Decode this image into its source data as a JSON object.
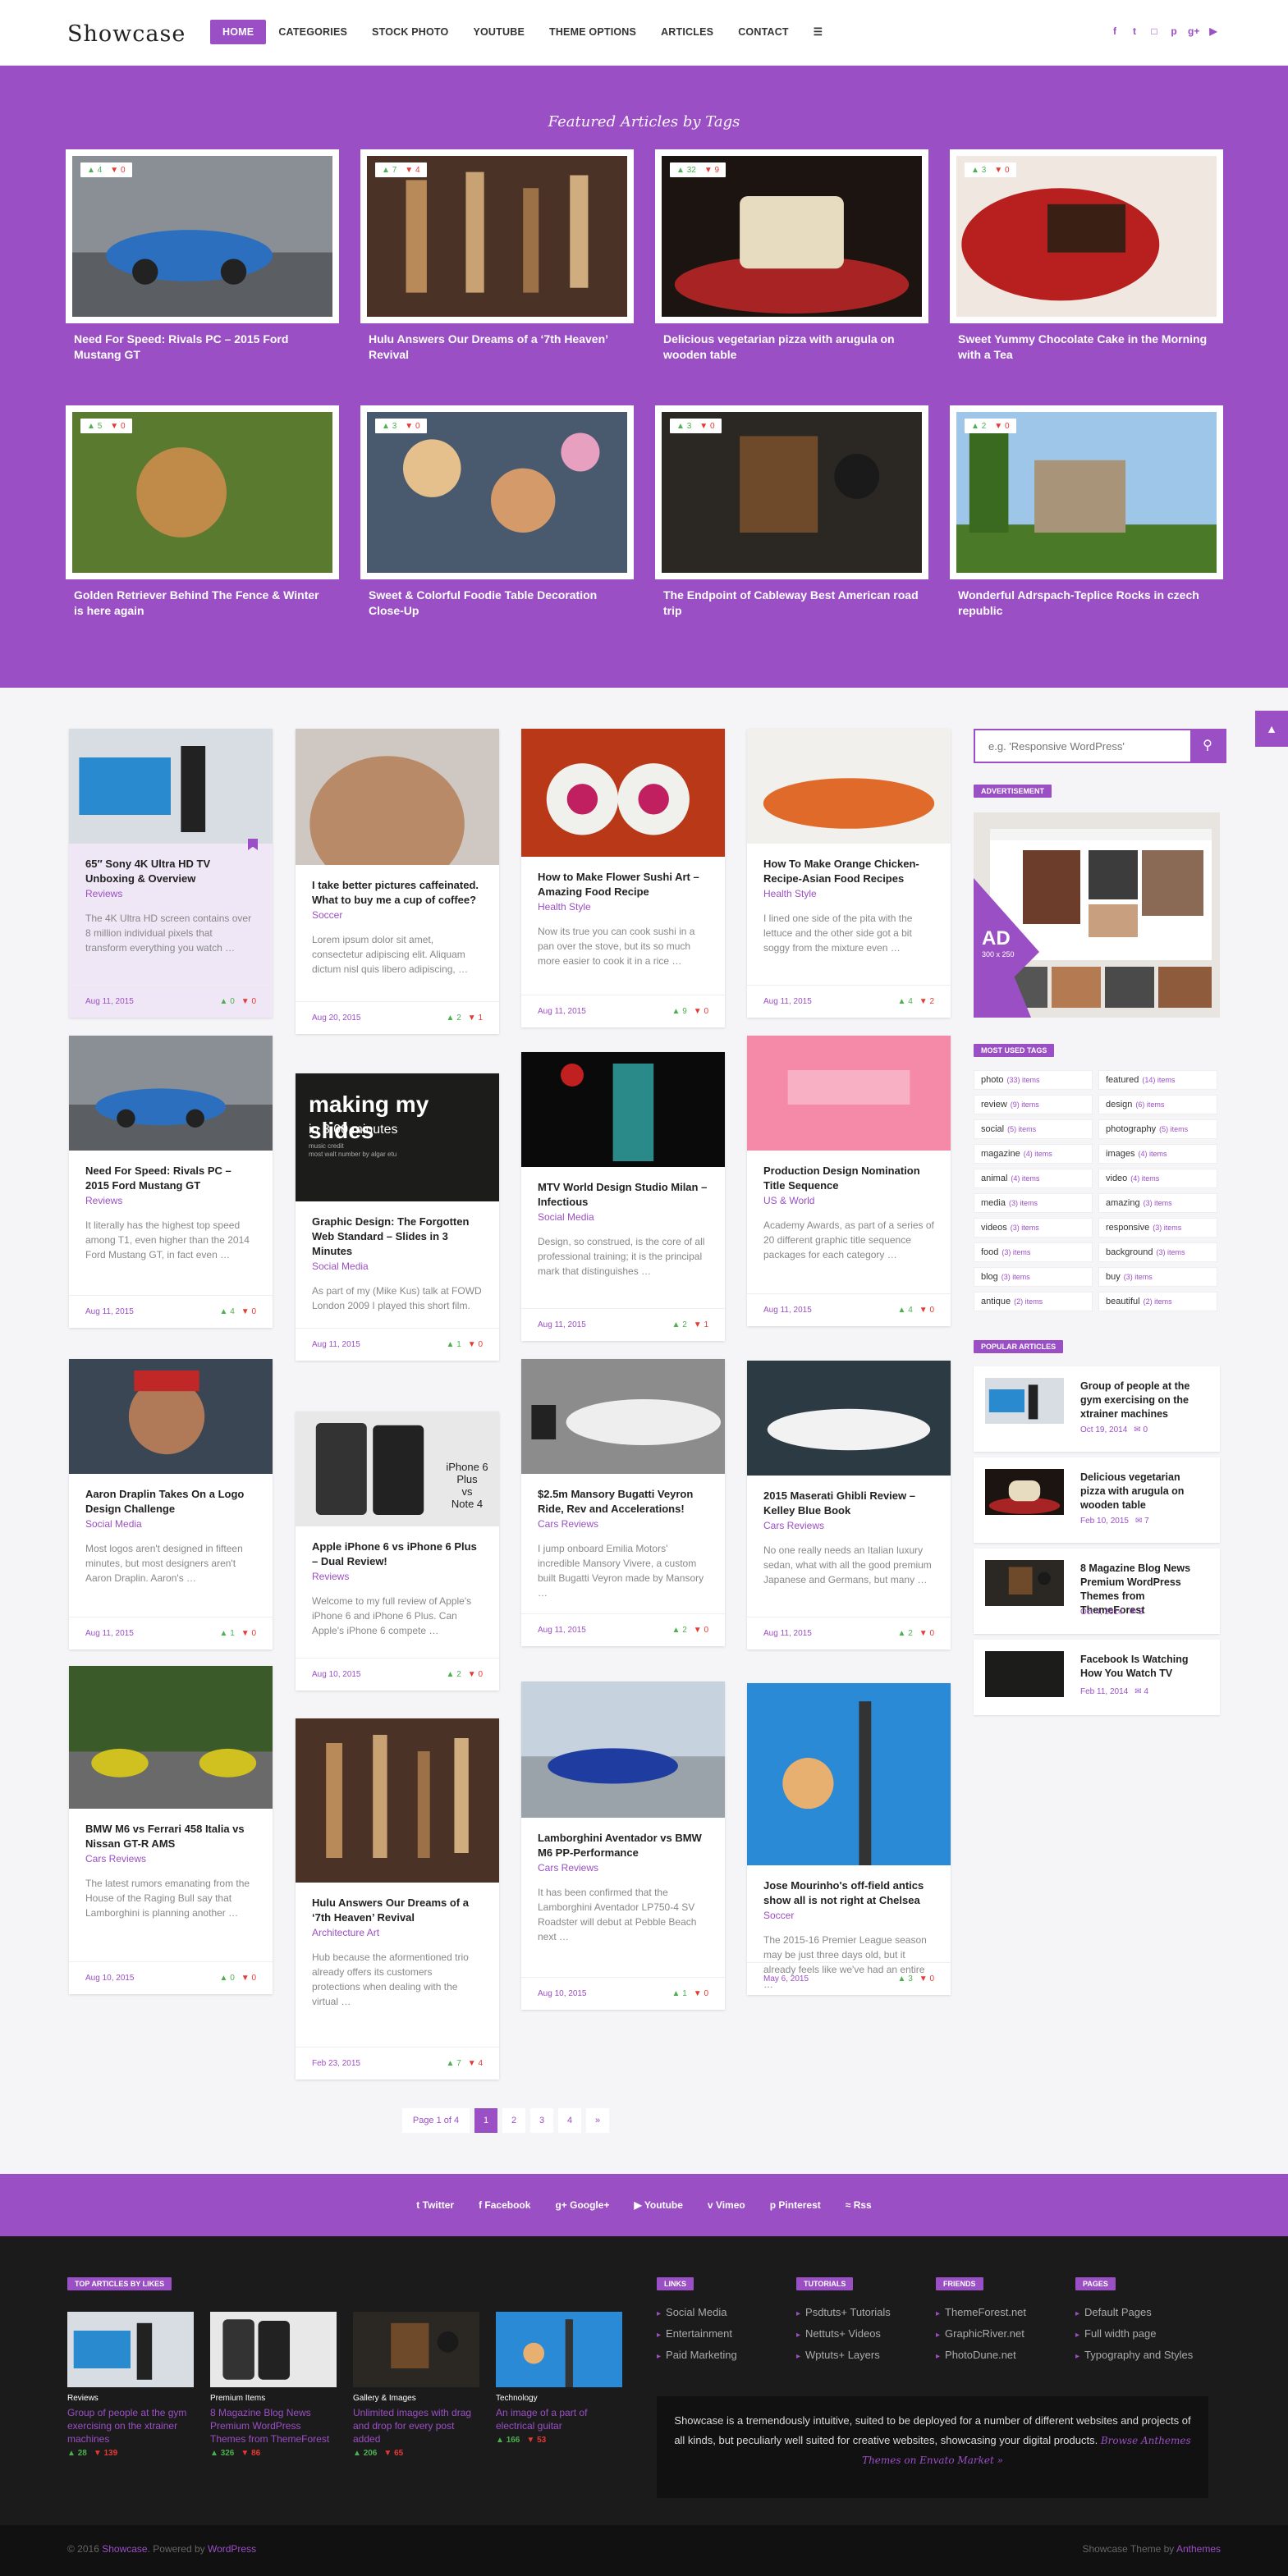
{
  "header": {
    "logo": "Showcase",
    "nav": [
      "Home",
      "Categories",
      "Stock Photo",
      "Youtube",
      "Theme Options",
      "Articles",
      "Contact"
    ],
    "menu_icon": "hamburger-icon",
    "social_icons": [
      "facebook-icon",
      "twitter-icon",
      "instagram-icon",
      "pinterest-icon",
      "google-plus-icon",
      "youtube-icon"
    ]
  },
  "featured": {
    "title": "Featured Articles by Tags",
    "items": [
      {
        "title": "Need For Speed: Rivals PC – 2015 Ford Mustang GT",
        "likes": "4",
        "dislikes": "0"
      },
      {
        "title": "Hulu Answers Our Dreams of a ‘7th Heaven’ Revival",
        "likes": "7",
        "dislikes": "4"
      },
      {
        "title": "Delicious vegetarian pizza with arugula on wooden table",
        "likes": "32",
        "dislikes": "9"
      },
      {
        "title": "Sweet Yummy Chocolate Cake in the Morning with a Tea",
        "likes": "3",
        "dislikes": "0"
      },
      {
        "title": "Golden Retriever Behind The Fence & Winter is here again",
        "likes": "5",
        "dislikes": "0"
      },
      {
        "title": "Sweet & Colorful Foodie Table Decoration Close-Up",
        "likes": "3",
        "dislikes": "0"
      },
      {
        "title": "The Endpoint of Cableway Best American road trip",
        "likes": "3",
        "dislikes": "0"
      },
      {
        "title": "Wonderful Adrspach-Teplice Rocks in czech republic",
        "likes": "2",
        "dislikes": "0"
      }
    ]
  },
  "posts": [
    {
      "title": "65″ Sony 4K Ultra HD TV Unboxing & Overview",
      "cat": "Reviews",
      "excerpt": "The 4K Ultra HD screen contains over 8 million individual pixels that transform everything you watch …",
      "date": "Aug 11, 2015",
      "likes": "0",
      "dislikes": "0"
    },
    {
      "title": "I take better pictures caffeinated. What to buy me a cup of coffee?",
      "cat": "Soccer",
      "excerpt": "Lorem ipsum dolor sit amet, consectetur adipiscing elit. Aliquam dictum nisl quis libero adipiscing, …",
      "date": "Aug 20, 2015",
      "likes": "2",
      "dislikes": "1"
    },
    {
      "title": "How to Make Flower Sushi Art – Amazing Food Recipe",
      "cat": "Health Style",
      "excerpt": "Now its true you can cook sushi in a pan over the stove, but its so much more easier to cook it in a rice …",
      "date": "Aug 11, 2015",
      "likes": "9",
      "dislikes": "0"
    },
    {
      "title": "How To Make Orange Chicken-Recipe-Asian Food Recipes",
      "cat": "Health Style",
      "excerpt": "I lined one side of the pita with the lettuce and the other side got a bit soggy from the mixture even …",
      "date": "Aug 11, 2015",
      "likes": "4",
      "dislikes": "2"
    },
    {
      "title": "Need For Speed: Rivals PC – 2015 Ford Mustang GT",
      "cat": "Reviews",
      "excerpt": "It literally has the highest top speed among T1, even higher than the 2014 Ford Mustang GT, in fact even …",
      "date": "Aug 11, 2015",
      "likes": "4",
      "dislikes": "0"
    },
    {
      "title": "Graphic Design: The Forgotten Web Standard – Slides in 3 Minutes",
      "cat": "Social Media",
      "excerpt": "As part of my (Mike Kus) talk at FOWD London 2009 I played this short film.",
      "date": "Aug 11, 2015",
      "likes": "1",
      "dislikes": "0"
    },
    {
      "title": "MTV World Design Studio Milan – Infectious",
      "cat": "Social Media",
      "excerpt": "Design, so construed, is the core of all professional training; it is the principal mark that distinguishes …",
      "date": "Aug 11, 2015",
      "likes": "2",
      "dislikes": "1"
    },
    {
      "title": "Production Design Nomination Title Sequence",
      "cat": "US & World",
      "excerpt": "Academy Awards, as part of a series of 20 different graphic title sequence packages for each category …",
      "date": "Aug 11, 2015",
      "likes": "4",
      "dislikes": "0"
    },
    {
      "title": "Aaron Draplin Takes On a Logo Design Challenge",
      "cat": "Social Media",
      "excerpt": "Most logos aren't designed in fifteen minutes, but most designers aren't Aaron Draplin. Aaron's …",
      "date": "Aug 11, 2015",
      "likes": "1",
      "dislikes": "0"
    },
    {
      "title": "Apple iPhone 6 vs iPhone 6 Plus – Dual Review!",
      "cat": "Reviews",
      "excerpt": "Welcome to my full review of Apple's iPhone 6 and iPhone 6 Plus. Can Apple's iPhone 6 compete …",
      "date": "Aug 10, 2015",
      "likes": "2",
      "dislikes": "0"
    },
    {
      "title": "$2.5m Mansory Bugatti Veyron Ride, Rev and Accelerations!",
      "cat": "Cars Reviews",
      "excerpt": "I jump onboard Emilia Motors' incredible Mansory Vivere, a custom built Bugatti Veyron made by Mansory …",
      "date": "Aug 11, 2015",
      "likes": "2",
      "dislikes": "0"
    },
    {
      "title": "2015 Maserati Ghibli Review – Kelley Blue Book",
      "cat": "Cars Reviews",
      "excerpt": "No one really needs an Italian luxury sedan, what with all the good premium Japanese and Germans, but many …",
      "date": "Aug 11, 2015",
      "likes": "2",
      "dislikes": "0"
    },
    {
      "title": "BMW M6 vs Ferrari 458 Italia vs Nissan GT-R AMS",
      "cat": "Cars Reviews",
      "excerpt": "The latest rumors emanating from the House of the Raging Bull say that Lamborghini is planning another …",
      "date": "Aug 10, 2015",
      "likes": "0",
      "dislikes": "0"
    },
    {
      "title": "Hulu Answers Our Dreams of a ‘7th Heaven’ Revival",
      "cat": "Architecture Art",
      "excerpt": "Hub because the aformentioned trio already offers its customers protections when dealing with the virtual …",
      "date": "Feb 23, 2015",
      "likes": "7",
      "dislikes": "4"
    },
    {
      "title": "Lamborghini Aventador vs BMW M6 PP-Performance",
      "cat": "Cars Reviews",
      "excerpt": "It has been confirmed that the Lamborghini Aventador LP750-4 SV Roadster will debut at Pebble Beach next …",
      "date": "Aug 10, 2015",
      "likes": "1",
      "dislikes": "0"
    },
    {
      "title": "Jose Mourinho's off-field antics show all is not right at Chelsea",
      "cat": "Soccer",
      "excerpt": "The 2015-16 Premier League season may be just three days old, but it already feels like we've had an entire …",
      "date": "May 6, 2015",
      "likes": "3",
      "dislikes": "0"
    }
  ],
  "img_texts": {
    "slides_big": "making my slides",
    "slides_small": "in 3.00 minutes",
    "slides_tiny": "music credit\nmost walt number by algar etu",
    "iphone": "iPhone 6 Plus\nvs\nNote 4"
  },
  "sidebar": {
    "search_placeholder": "e.g. 'Responsive WordPress'",
    "ad_label": "Advertisement",
    "ad_text": "AD",
    "ad_size": "300 x 250",
    "tags_label": "Most Used Tags",
    "tags": [
      {
        "name": "photo",
        "count": "(33) items"
      },
      {
        "name": "featured",
        "count": "(14) items"
      },
      {
        "name": "review",
        "count": "(9) items"
      },
      {
        "name": "design",
        "count": "(6) items"
      },
      {
        "name": "social",
        "count": "(5) items"
      },
      {
        "name": "photography",
        "count": "(5) items"
      },
      {
        "name": "magazine",
        "count": "(4) items"
      },
      {
        "name": "images",
        "count": "(4) items"
      },
      {
        "name": "animal",
        "count": "(4) items"
      },
      {
        "name": "video",
        "count": "(4) items"
      },
      {
        "name": "media",
        "count": "(3) items"
      },
      {
        "name": "amazing",
        "count": "(3) items"
      },
      {
        "name": "videos",
        "count": "(3) items"
      },
      {
        "name": "responsive",
        "count": "(3) items"
      },
      {
        "name": "food",
        "count": "(3) items"
      },
      {
        "name": "background",
        "count": "(3) items"
      },
      {
        "name": "blog",
        "count": "(3) items"
      },
      {
        "name": "buy",
        "count": "(3) items"
      },
      {
        "name": "antique",
        "count": "(2) items"
      },
      {
        "name": "beautiful",
        "count": "(2) items"
      }
    ],
    "popular_label": "Popular Articles",
    "popular": [
      {
        "title": "Group of people at the gym exercising on the xtrainer machines",
        "date": "Oct 19, 2014",
        "comments": "0"
      },
      {
        "title": "Delicious vegetarian pizza with arugula on wooden table",
        "date": "Feb 10, 2015",
        "comments": "7"
      },
      {
        "title": "8 Magazine Blog News Premium WordPress Themes from ThemeForest",
        "date": "Oct 4, 2014",
        "comments": "3"
      },
      {
        "title": "Facebook Is Watching How You Watch TV",
        "date": "Feb 11, 2014",
        "comments": "4"
      }
    ]
  },
  "pagination": {
    "label": "Page 1 of 4",
    "pages": [
      "1",
      "2",
      "3",
      "4"
    ],
    "next": "»"
  },
  "social_bar": [
    "Twitter",
    "Facebook",
    "Google+",
    "Youtube",
    "Vimeo",
    "Pinterest",
    "Rss"
  ],
  "footer": {
    "top_label": "Top Articles by Likes",
    "top": [
      {
        "cat": "Reviews",
        "title": "Group of people at the gym exercising on the xtrainer machines",
        "likes": "28",
        "dislikes": "139"
      },
      {
        "cat": "Premium Items",
        "title": "8 Magazine Blog News Premium WordPress Themes from ThemeForest",
        "likes": "326",
        "dislikes": "86"
      },
      {
        "cat": "Gallery & Images",
        "title": "Unlimited images with drag and drop for every post added",
        "likes": "206",
        "dislikes": "65"
      },
      {
        "cat": "Technology",
        "title": "An image of a part of electrical guitar",
        "likes": "166",
        "dislikes": "53"
      }
    ],
    "columns": [
      {
        "label": "Links",
        "items": [
          "Social Media",
          "Entertainment",
          "Paid Marketing"
        ]
      },
      {
        "label": "Tutorials",
        "items": [
          "Psdtuts+ Tutorials",
          "Nettuts+ Videos",
          "Wptuts+ Layers"
        ]
      },
      {
        "label": "Friends",
        "items": [
          "ThemeForest.net",
          "GraphicRiver.net",
          "PhotoDune.net"
        ]
      },
      {
        "label": "Pages",
        "items": [
          "Default Pages",
          "Full width page",
          "Typography and Styles"
        ]
      }
    ],
    "about": "Showcase is a tremendously intuitive, suited to be deployed for a number of different websites and projects of all kinds, but peculiarly well suited for creative websites, showcasing your digital products.",
    "about_link": "Browse Anthemes Themes on Envato Market »",
    "copy_left": "© 2016 ",
    "copy_brand": "Showcase",
    "copy_mid": ". Powered by ",
    "copy_wp": "WordPress",
    "copy_right": "Showcase Theme by ",
    "copy_author": "Anthemes"
  },
  "colors": {
    "accent": "#9b4fc4",
    "like": "#4caf50",
    "dislike": "#e53935"
  }
}
